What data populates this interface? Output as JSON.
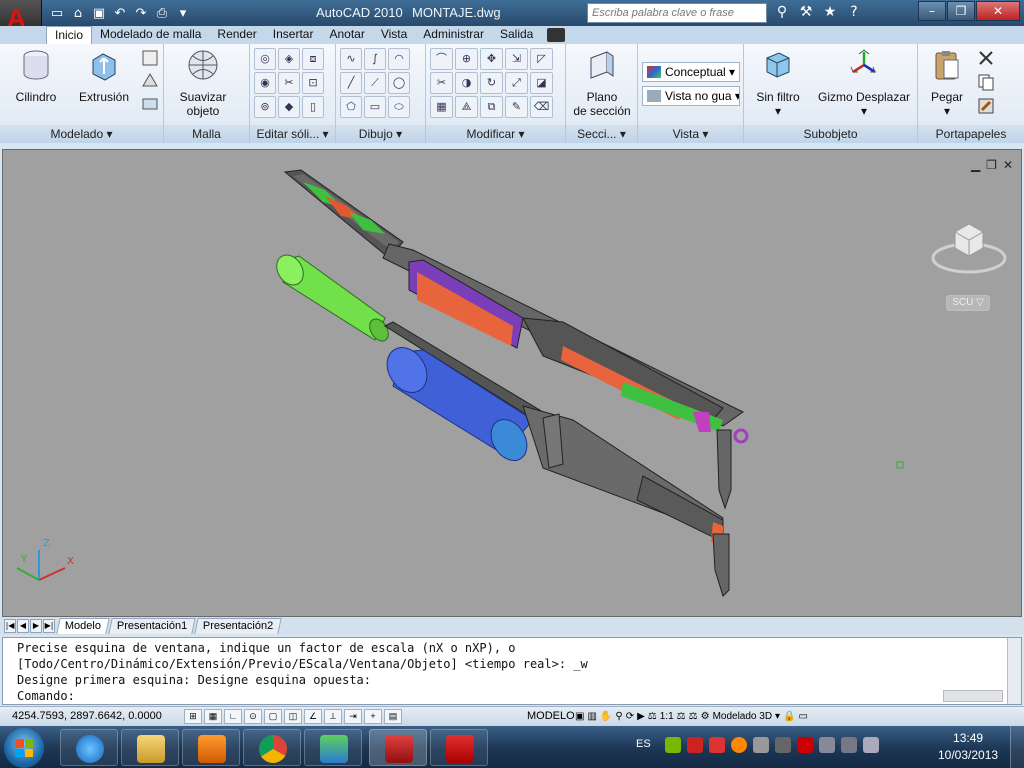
{
  "window": {
    "app_title": "AutoCAD 2010",
    "file_title": "MONTAJE.dwg",
    "search_placeholder": "Escriba palabra clave o frase"
  },
  "ribbon_tabs": [
    "Inicio",
    "Modelado de malla",
    "Render",
    "Insertar",
    "Anotar",
    "Vista",
    "Administrar",
    "Salida"
  ],
  "ribbon": {
    "modelado": {
      "title": "Modelado",
      "cilindro": "Cilindro",
      "extrusion": "Extrusión"
    },
    "malla": {
      "title": "Malla",
      "suavizar_1": "Suavizar",
      "suavizar_2": "objeto"
    },
    "editar": {
      "title": "Editar sóli..."
    },
    "dibujo": {
      "title": "Dibujo"
    },
    "modificar": {
      "title": "Modificar"
    },
    "seccion": {
      "title": "Secci...",
      "plano_1": "Plano",
      "plano_2": "de sección"
    },
    "vista": {
      "title": "Vista",
      "visual_style": "Conceptual",
      "view": "Vista no gua"
    },
    "subobjeto": {
      "title": "Subobjeto",
      "sin_filtro": "Sin filtro",
      "gizmo": "Gizmo Desplazar"
    },
    "portapapeles": {
      "title": "Portapapeles",
      "pegar": "Pegar"
    }
  },
  "viewport": {
    "scu_label": "SCU"
  },
  "layout_tabs": [
    "Modelo",
    "Presentación1",
    "Presentación2"
  ],
  "command_lines": [
    "Precise esquina de ventana, indique un factor de escala (nX o nXP), o",
    "[Todo/Centro/Dinámico/Extensión/Previo/EScala/Ventana/Objeto] <tiempo real>: _w",
    "Designe primera esquina: Designe esquina opuesta:",
    "Comando:"
  ],
  "status": {
    "coords": "4254.7593, 2897.6642, 0.0000",
    "model": "MODELO",
    "scale": "1:1",
    "workspace": "Modelado 3D"
  },
  "taskbar": {
    "lang": "ES",
    "time": "13:49",
    "date": "10/03/2013"
  },
  "colors": {
    "viewport_bg": "#a0a0a0",
    "accent_red": "#e01010",
    "title_blue": "#284a6c"
  }
}
